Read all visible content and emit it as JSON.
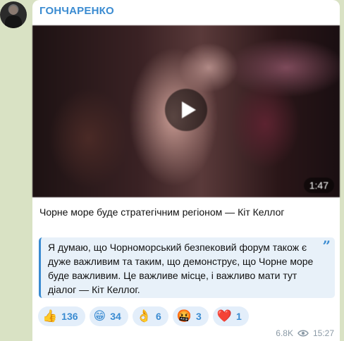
{
  "post": {
    "sender": "ГОНЧАРЕНКО",
    "video_duration": "1:47",
    "headline": "Чорне море буде стратегічним регіоном — Кіт Келлог",
    "quote": "Я думаю, що Чорноморський безпековий форум також є дуже важливим та таким, що демонструє, що Чорне море буде важливим. Це важливе місце, і важливо мати тут діалог — Кіт Келлог.",
    "quote_icon": "quote-icon",
    "views": "6.8K",
    "time": "15:27"
  },
  "reactions": [
    {
      "emoji": "👍",
      "count": "136"
    },
    {
      "emoji": "😁",
      "count": "34"
    },
    {
      "emoji": "👌",
      "count": "6"
    },
    {
      "emoji": "🤬",
      "count": "3"
    },
    {
      "emoji": "❤️",
      "count": "1"
    }
  ],
  "colors": {
    "accent": "#3a8bd1",
    "chat_bg": "#d9e2c4",
    "bubble": "#ffffff",
    "quote_bg": "#e8f1f9"
  }
}
